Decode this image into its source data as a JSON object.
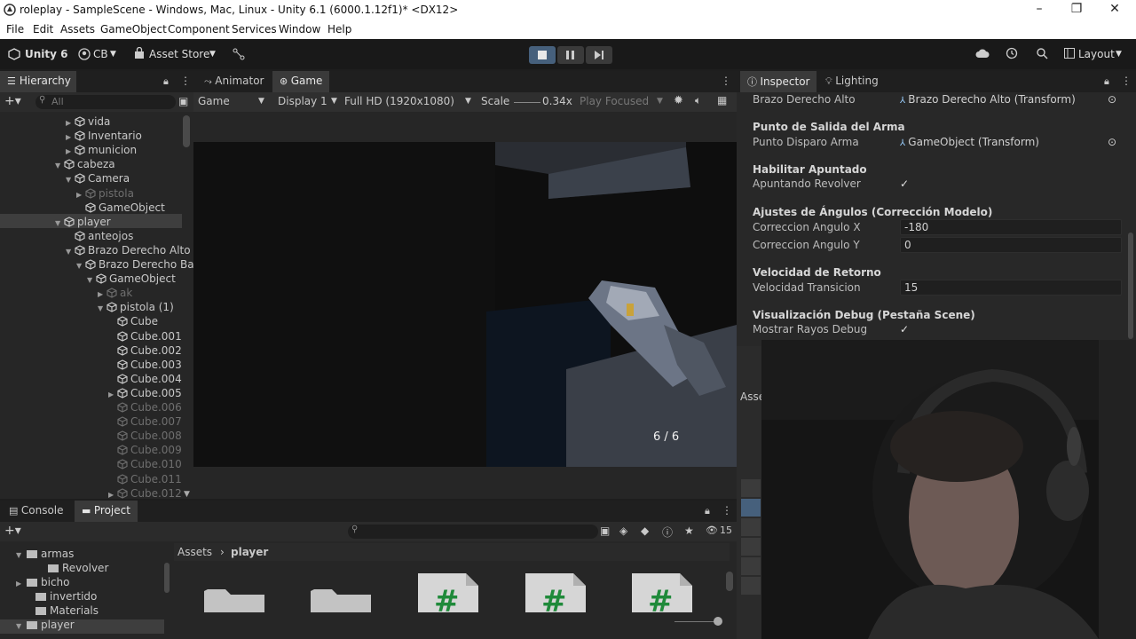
{
  "window": {
    "title": "roleplay - SampleScene - Windows, Mac, Linux - Unity 6.1 (6000.1.12f1)* <DX12>",
    "minimize": "–",
    "maximize": "❐",
    "close": "✕"
  },
  "menu": [
    "File",
    "Edit",
    "Assets",
    "GameObject",
    "Component",
    "Services",
    "Window",
    "Help"
  ],
  "toolbar": {
    "brand": "Unity 6",
    "account": "CB",
    "asset_store": "Asset Store",
    "layout": "Layout"
  },
  "hierarchy": {
    "tab": "Hierarchy",
    "search_placeholder": "All",
    "items": [
      {
        "label": "vida",
        "dim": false
      },
      {
        "label": "Inventario",
        "dim": false
      },
      {
        "label": "municion",
        "dim": false
      },
      {
        "label": "cabeza",
        "dim": false
      },
      {
        "label": "Camera",
        "dim": false
      },
      {
        "label": "pistola",
        "dim": true
      },
      {
        "label": "GameObject",
        "dim": false
      },
      {
        "label": "player",
        "dim": false
      },
      {
        "label": "anteojos",
        "dim": false
      },
      {
        "label": "Brazo Derecho Alto",
        "dim": false
      },
      {
        "label": "Brazo Derecho Ba",
        "dim": false
      },
      {
        "label": "GameObject",
        "dim": false
      },
      {
        "label": "ak",
        "dim": true
      },
      {
        "label": "pistola (1)",
        "dim": false
      },
      {
        "label": "Cube",
        "dim": false
      },
      {
        "label": "Cube.001",
        "dim": false
      },
      {
        "label": "Cube.002",
        "dim": false
      },
      {
        "label": "Cube.003",
        "dim": false
      },
      {
        "label": "Cube.004",
        "dim": false
      },
      {
        "label": "Cube.005",
        "dim": false
      },
      {
        "label": "Cube.006",
        "dim": true
      },
      {
        "label": "Cube.007",
        "dim": true
      },
      {
        "label": "Cube.008",
        "dim": true
      },
      {
        "label": "Cube.009",
        "dim": true
      },
      {
        "label": "Cube.010",
        "dim": true
      },
      {
        "label": "Cube.011",
        "dim": true
      },
      {
        "label": "Cube.012",
        "dim": true
      }
    ]
  },
  "game": {
    "tabs": [
      "Animator",
      "Game"
    ],
    "view_mode": "Game",
    "display": "Display 1",
    "resolution": "Full HD (1920x1080)",
    "scale_label": "Scale",
    "scale_value": "0.34x",
    "play_mode": "Play Focused",
    "ammo": "6 / 6"
  },
  "inspector": {
    "tabs": [
      "Inspector",
      "Lighting"
    ],
    "rows": [
      {
        "kind": "obj",
        "label": "Brazo Derecho Alto",
        "value": "Brazo Derecho Alto (Transform)"
      },
      {
        "kind": "head",
        "label": "Punto de Salida del Arma"
      },
      {
        "kind": "obj",
        "label": "Punto Disparo Arma",
        "value": "GameObject (Transform)"
      },
      {
        "kind": "head",
        "label": "Habilitar Apuntado"
      },
      {
        "kind": "check",
        "label": "Apuntando Revolver",
        "value": "✓"
      },
      {
        "kind": "head",
        "label": "Ajustes de Ángulos (Corrección Modelo)"
      },
      {
        "kind": "field",
        "label": "Correccion Angulo X",
        "value": "-180"
      },
      {
        "kind": "field",
        "label": "Correccion Angulo Y",
        "value": "0"
      },
      {
        "kind": "head",
        "label": "Velocidad de Retorno"
      },
      {
        "kind": "field",
        "label": "Velocidad Transicion",
        "value": "15"
      },
      {
        "kind": "head",
        "label": "Visualización Debug (Pestaña Scene)"
      },
      {
        "kind": "check",
        "label": "Mostrar Rayos Debug",
        "value": "✓"
      }
    ],
    "partial_tab": "Asse"
  },
  "project": {
    "tabs": [
      "Console",
      "Project"
    ],
    "tree": [
      "armas",
      "Revolver",
      "bicho",
      "invertido",
      "Materials",
      "player"
    ],
    "breadcrumb": [
      "Assets",
      "player"
    ],
    "count": "15",
    "script_glyph": "#"
  },
  "colors": {
    "accent": "#3a79bb",
    "selected_row": "#3e3e3e",
    "play_active": "#46607c",
    "script_green": "#1f8a3a"
  }
}
